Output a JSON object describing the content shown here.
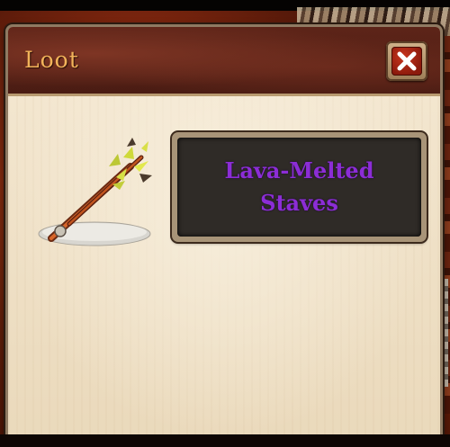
{
  "loot_window": {
    "title": "Loot",
    "close_icon": "close-x-icon",
    "item": {
      "icon": "lava-melted-staves-icon",
      "name": "Lava-Melted Staves",
      "rarity_color": "#8c2dd6"
    }
  },
  "colors": {
    "title_text": "#f2b35a",
    "title_bar": "#5d2418",
    "parchment": "#f3e6cf",
    "close_button": "#c9361e",
    "item_frame": "#2f2b27"
  }
}
